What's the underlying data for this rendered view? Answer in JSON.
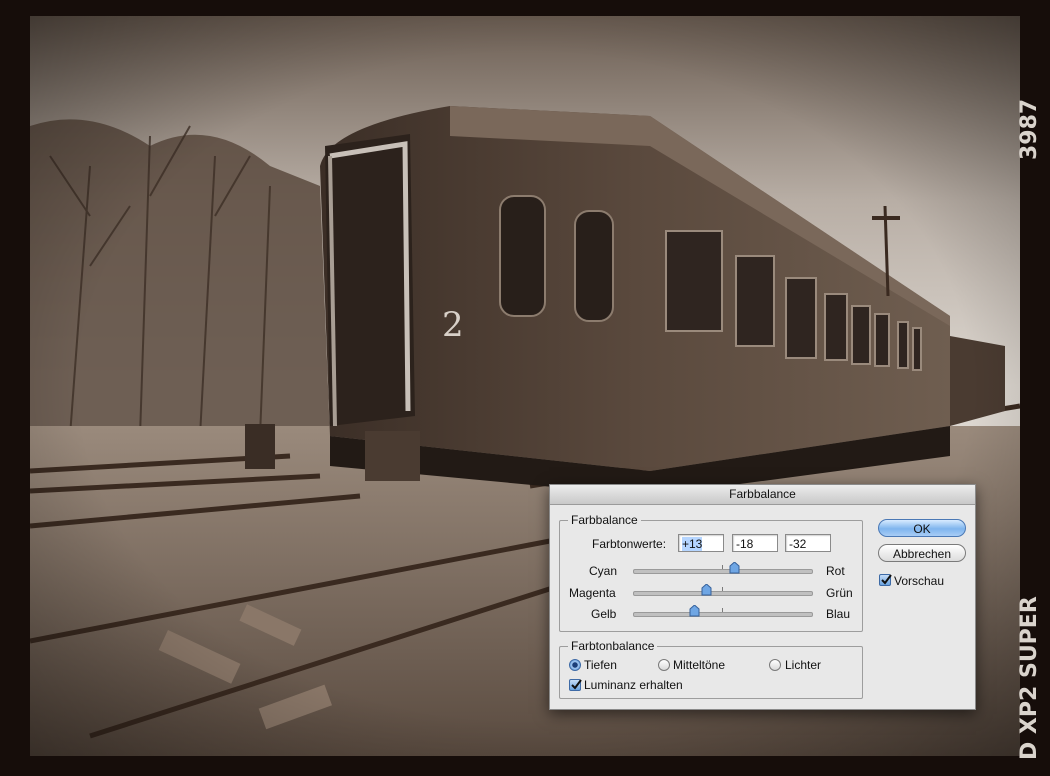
{
  "film": {
    "edge_number": "3987",
    "edge_brand": "D XP2 SUPER"
  },
  "dialog": {
    "title": "Farbbalance",
    "color_balance": {
      "group_label": "Farbbalance",
      "values_label": "Farbtonwerte:",
      "values": [
        "+13",
        "-18",
        "-32"
      ],
      "sliders": [
        {
          "left": "Cyan",
          "right": "Rot",
          "value": 13
        },
        {
          "left": "Magenta",
          "right": "Grün",
          "value": -18
        },
        {
          "left": "Gelb",
          "right": "Blau",
          "value": -32
        }
      ],
      "slider_range": [
        -100,
        100
      ]
    },
    "tone_balance": {
      "group_label": "Farbtonbalance",
      "options": [
        "Tiefen",
        "Mitteltöne",
        "Lichter"
      ],
      "selected": "Tiefen",
      "preserve_luminosity_label": "Luminanz erhalten",
      "preserve_luminosity_checked": true
    },
    "buttons": {
      "ok": "OK",
      "cancel": "Abbrechen"
    },
    "preview": {
      "label": "Vorschau",
      "checked": true
    }
  },
  "colors": {
    "sepia_dark": "#3a2a20",
    "sepia_mid": "#6e5a4a",
    "sepia_light": "#d9d3cc",
    "accent_blue": "#5e97d8"
  }
}
